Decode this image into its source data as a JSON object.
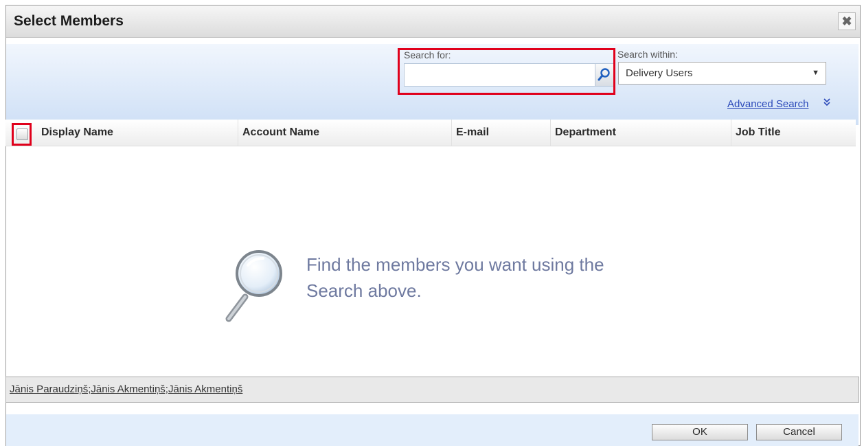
{
  "dialog": {
    "title": "Select Members",
    "close_glyph": "✖"
  },
  "search": {
    "label": "Search for:",
    "value": "",
    "button_icon": "magnifier-icon"
  },
  "within": {
    "label": "Search within:",
    "selected": "Delivery Users",
    "arrow_glyph": "▼"
  },
  "advanced": {
    "label": "Advanced Search",
    "icon_glyph": "»"
  },
  "table": {
    "columns": [
      "Display Name",
      "Account Name",
      "E-mail",
      "Department",
      "Job Title"
    ]
  },
  "empty_state": {
    "line1": "Find the members you want using the",
    "line2": "Search above."
  },
  "selected_members": "Jānis Paraudziņš;Jānis Akmentiņš;Jānis Akmentiņš",
  "buttons": {
    "ok": "OK",
    "cancel": "Cancel"
  },
  "colors": {
    "highlight": "#e0001b",
    "link": "#2a48b9",
    "empty_text": "#6f7aa0"
  }
}
